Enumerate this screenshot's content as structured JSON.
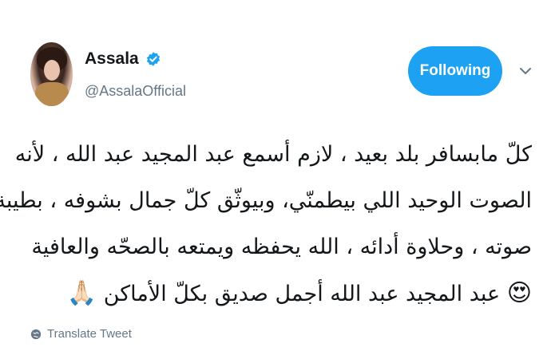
{
  "tweet": {
    "author_name": "Assala",
    "handle": "@AssalaOfficial",
    "verified": true,
    "follow_label": "Following",
    "accent_color": "#1da1f2",
    "text_lines": [
      "كلّ مابسافر بلد بعيد ، لازم أسمع عبد المجيد عبد الله ، لأنه",
      "الصوت الوحيد اللي بيطمنّي، وبيوثّق كلّ جمال بشوفه ، بطيبة",
      "صوته ، وحلاوة أدائه ، الله يحفظه ويمتعه بالصحّه والعافية",
      "عبد المجيد عبد الله أجمل صديق بكلّ الأماكن"
    ],
    "trailing_emoji": "😍",
    "leading_emoji": "🙏🏻",
    "translate_label": "Translate Tweet"
  }
}
